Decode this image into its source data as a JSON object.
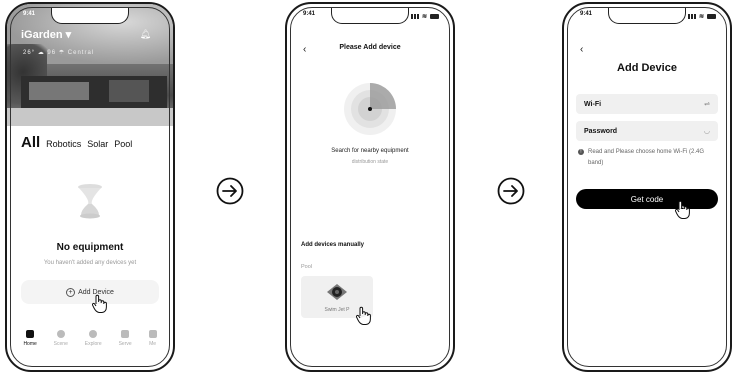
{
  "status": {
    "time": "9:41"
  },
  "screen1": {
    "app_title": "iGarden",
    "weather": "26°   ☁ 96   ☂ Central",
    "categories": [
      "All",
      "Robotics",
      "Solar",
      "Pool"
    ],
    "empty_title": "No equipment",
    "empty_sub": "You haven't added any devices yet",
    "add_device": "Add Device",
    "tabs": [
      "Home",
      "Scene",
      "Explore",
      "Serve",
      "Me"
    ]
  },
  "screen2": {
    "title": "Please Add device",
    "search_title": "Search for nearby equipment",
    "search_sub": "distribution state",
    "manual_title": "Add devices manually",
    "section": "Pool",
    "device_name": "Swim Jet P"
  },
  "screen3": {
    "title": "Add Device",
    "wifi_label": "Wi-Fi",
    "password_label": "Password",
    "note": "Read and Please choose home Wi-Fi (2.4G band)",
    "button": "Get code"
  },
  "colors": {
    "primary": "#000000",
    "field_bg": "#f0f0f0",
    "muted": "#999999"
  }
}
